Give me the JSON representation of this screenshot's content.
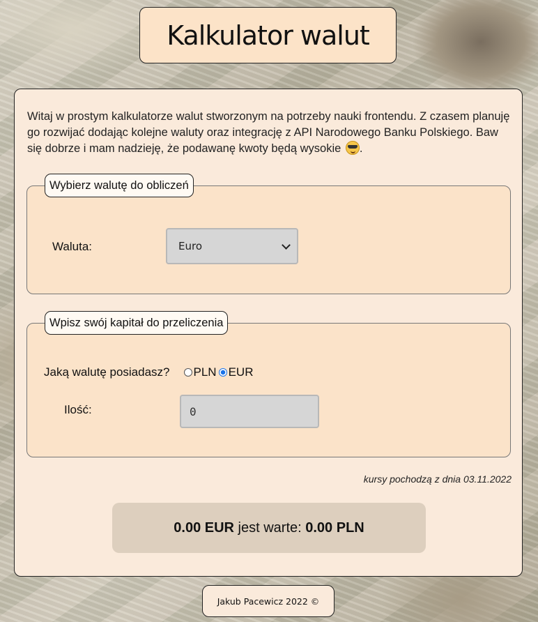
{
  "header": {
    "title": "Kalkulator walut"
  },
  "intro": {
    "text": "Witaj w prostym kalkulatorze walut stworzonym na potrzeby nauki frontendu. Z czasem planuję go rozwijać dodając kolejne waluty oraz integrację z API Narodowego Banku Polskiego. Baw się dobrze i mam nadzieję, że podawanę kwoty będą wysokie",
    "emoji_icon": "sunglasses-emoji-icon"
  },
  "currency_section": {
    "legend": "Wybierz walutę do obliczeń",
    "label": "Waluta:",
    "selected": "Euro"
  },
  "capital_section": {
    "legend": "Wpisz swój kapitał do przeliczenia",
    "question": "Jaką walutę posiadasz?",
    "options": [
      {
        "label": "PLN",
        "checked": false
      },
      {
        "label": "EUR",
        "checked": true
      }
    ],
    "amount_label": "Ilość:",
    "amount_placeholder": "0"
  },
  "rates_note": "kursy pochodzą z dnia 03.11.2022",
  "result": {
    "from_amount": "0.00 EUR",
    "middle_text": " jest warte: ",
    "to_amount": "0.00 PLN"
  },
  "footer": {
    "text": "Jakub Pacewicz 2022 ©"
  },
  "colors": {
    "card_bg": "#faeadb",
    "fieldset_bg": "#fbe3c9",
    "header_bg": "#fce3c8",
    "result_bg": "#ddcfbe",
    "radio_accent": "#1a73e8"
  }
}
